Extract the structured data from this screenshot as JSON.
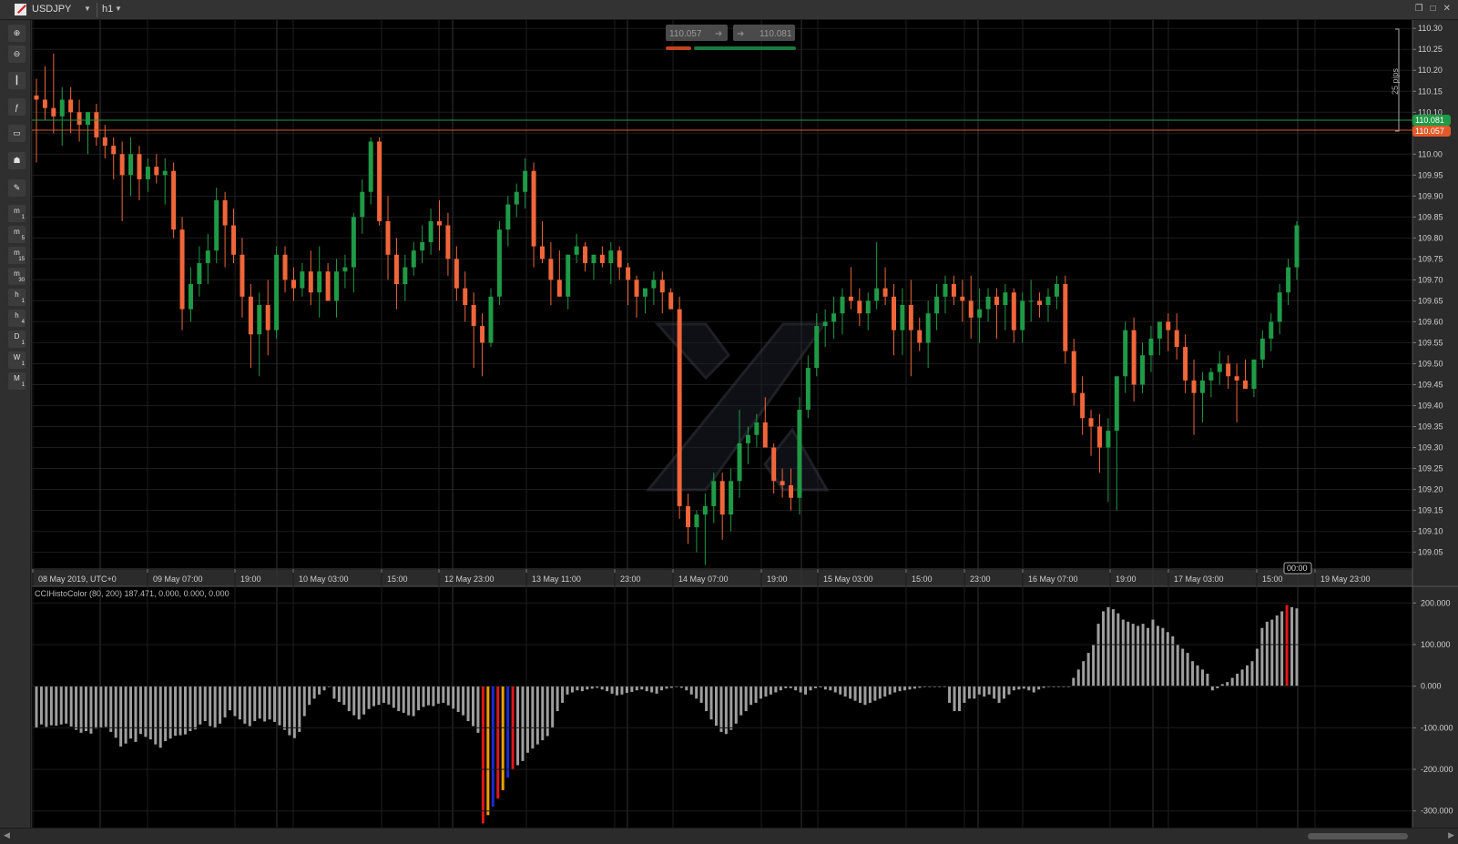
{
  "header": {
    "symbol": "USDJPY",
    "timeframe": "h1",
    "icons": [
      "dropdown-icon",
      "restore-icon",
      "maximize-icon",
      "close-icon"
    ]
  },
  "toolbar": {
    "tools": [
      {
        "name": "zoom-in",
        "icon": "zoom-in-icon"
      },
      {
        "name": "zoom-out",
        "icon": "zoom-out-icon"
      },
      {
        "name": "chart-type",
        "icon": "candles-icon"
      },
      {
        "name": "indicators",
        "icon": "indicator-icon"
      },
      {
        "name": "objects",
        "icon": "objects-icon"
      },
      {
        "name": "templates",
        "icon": "user-icon"
      },
      {
        "name": "settings",
        "icon": "settings-icon"
      }
    ],
    "timeframes": [
      {
        "main": "m",
        "sub": "1"
      },
      {
        "main": "m",
        "sub": "5"
      },
      {
        "main": "m",
        "sub": "15"
      },
      {
        "main": "m",
        "sub": "30"
      },
      {
        "main": "h",
        "sub": "1"
      },
      {
        "main": "h",
        "sub": "4"
      },
      {
        "main": "D",
        "sub": "1"
      },
      {
        "main": "W",
        "sub": "1"
      },
      {
        "main": "M",
        "sub": "1"
      }
    ]
  },
  "quick_trade": {
    "sell_price": "110.057",
    "buy_price": "110.081"
  },
  "price_scale": {
    "labels": [
      "110.30",
      "110.25",
      "110.20",
      "110.15",
      "110.10",
      "110.05",
      "110.00",
      "109.95",
      "109.90",
      "109.85",
      "109.80",
      "109.75",
      "109.70",
      "109.65",
      "109.60",
      "109.55",
      "109.50",
      "109.45",
      "109.40",
      "109.35",
      "109.30",
      "109.25",
      "109.20",
      "109.15",
      "109.10",
      "109.05"
    ],
    "ask_label": "110.081",
    "bid_label": "110.057",
    "pips_label": "25 pips",
    "ask_color": "#1f9a46",
    "bid_color": "#e05a28"
  },
  "time_scale": {
    "labels": [
      "08 May 2019, UTC+0",
      "09 May 07:00",
      "19:00",
      "10 May 03:00",
      "15:00",
      "12 May 23:00",
      "13 May 11:00",
      "23:00",
      "14 May 07:00",
      "19:00",
      "15 May 03:00",
      "15:00",
      "23:00",
      "16 May 07:00",
      "19:00",
      "17 May 03:00",
      "15:00",
      "19 May 23:00"
    ],
    "cursor_label": "00:00"
  },
  "indicator": {
    "title": "CCIHistoColor (80, 200) 187.471, 0.000, 0.000, 0.000",
    "scale_labels": [
      "200.000",
      "100.000",
      "0.000",
      "-100.000",
      "-200.000",
      "-300.000"
    ]
  },
  "colors": {
    "background": "#000000",
    "bull": "#1f9a46",
    "bear": "#f0663a",
    "histogram": "#9e9e9e",
    "hist_red": "#e01818",
    "hist_orange": "#f0a000",
    "hist_blue": "#1a2ad8"
  },
  "chart_data": {
    "type": "candlestick",
    "title": "",
    "ylim": [
      109.01,
      110.32
    ],
    "candle_count": 152,
    "ohlc": [
      [
        110.14,
        110.18,
        109.98,
        110.13
      ],
      [
        110.13,
        110.21,
        110.08,
        110.11
      ],
      [
        110.11,
        110.24,
        110.05,
        110.09
      ],
      [
        110.09,
        110.16,
        110.02,
        110.13
      ],
      [
        110.13,
        110.16,
        110.05,
        110.1
      ],
      [
        110.1,
        110.13,
        110.03,
        110.07
      ],
      [
        110.07,
        110.1,
        110.0,
        110.1
      ],
      [
        110.1,
        110.12,
        110.02,
        110.04
      ],
      [
        110.04,
        110.07,
        109.99,
        110.02
      ],
      [
        110.02,
        110.04,
        109.94,
        110.0
      ],
      [
        110.0,
        110.03,
        109.84,
        109.95
      ],
      [
        109.95,
        110.04,
        109.9,
        110.0
      ],
      [
        110.0,
        110.02,
        109.89,
        109.94
      ],
      [
        109.94,
        109.99,
        109.91,
        109.97
      ],
      [
        109.97,
        110.0,
        109.93,
        109.95
      ],
      [
        109.95,
        109.99,
        109.88,
        109.96
      ],
      [
        109.96,
        109.98,
        109.8,
        109.82
      ],
      [
        109.82,
        109.85,
        109.58,
        109.63
      ],
      [
        109.63,
        109.73,
        109.6,
        109.69
      ],
      [
        109.69,
        109.78,
        109.66,
        109.74
      ],
      [
        109.74,
        109.81,
        109.69,
        109.77
      ],
      [
        109.77,
        109.92,
        109.74,
        109.89
      ],
      [
        109.89,
        109.91,
        109.73,
        109.83
      ],
      [
        109.83,
        109.87,
        109.74,
        109.76
      ],
      [
        109.76,
        109.8,
        109.61,
        109.66
      ],
      [
        109.66,
        109.69,
        109.49,
        109.57
      ],
      [
        109.57,
        109.67,
        109.47,
        109.64
      ],
      [
        109.64,
        109.7,
        109.52,
        109.58
      ],
      [
        109.58,
        109.78,
        109.56,
        109.76
      ],
      [
        109.76,
        109.78,
        109.67,
        109.7
      ],
      [
        109.7,
        109.73,
        109.65,
        109.68
      ],
      [
        109.68,
        109.74,
        109.66,
        109.72
      ],
      [
        109.72,
        109.77,
        109.64,
        109.67
      ],
      [
        109.67,
        109.78,
        109.61,
        109.72
      ],
      [
        109.72,
        109.74,
        109.65,
        109.65
      ],
      [
        109.65,
        109.75,
        109.61,
        109.72
      ],
      [
        109.72,
        109.76,
        109.68,
        109.73
      ],
      [
        109.73,
        109.86,
        109.67,
        109.85
      ],
      [
        109.85,
        109.94,
        109.81,
        109.91
      ],
      [
        109.91,
        110.04,
        109.88,
        110.03
      ],
      [
        110.03,
        110.04,
        109.83,
        109.84
      ],
      [
        109.84,
        109.9,
        109.7,
        109.76
      ],
      [
        109.76,
        109.8,
        109.63,
        109.69
      ],
      [
        109.69,
        109.76,
        109.65,
        109.73
      ],
      [
        109.73,
        109.79,
        109.71,
        109.77
      ],
      [
        109.77,
        109.83,
        109.74,
        109.79
      ],
      [
        109.79,
        109.87,
        109.76,
        109.84
      ],
      [
        109.84,
        109.89,
        109.77,
        109.83
      ],
      [
        109.83,
        109.86,
        109.71,
        109.75
      ],
      [
        109.75,
        109.78,
        109.65,
        109.68
      ],
      [
        109.68,
        109.72,
        109.6,
        109.64
      ],
      [
        109.64,
        109.67,
        109.49,
        109.59
      ],
      [
        109.59,
        109.62,
        109.47,
        109.55
      ],
      [
        109.55,
        109.68,
        109.54,
        109.66
      ],
      [
        109.66,
        109.84,
        109.64,
        109.82
      ],
      [
        109.82,
        109.9,
        109.78,
        109.88
      ],
      [
        109.88,
        109.93,
        109.85,
        109.91
      ],
      [
        109.91,
        109.99,
        109.87,
        109.96
      ],
      [
        109.96,
        109.98,
        109.73,
        109.78
      ],
      [
        109.78,
        109.84,
        109.74,
        109.75
      ],
      [
        109.75,
        109.79,
        109.64,
        109.7
      ],
      [
        109.7,
        109.77,
        109.66,
        109.66
      ],
      [
        109.66,
        109.76,
        109.63,
        109.76
      ],
      [
        109.76,
        109.81,
        109.74,
        109.78
      ],
      [
        109.78,
        109.79,
        109.72,
        109.74
      ],
      [
        109.74,
        109.76,
        109.7,
        109.76
      ],
      [
        109.76,
        109.78,
        109.73,
        109.74
      ],
      [
        109.74,
        109.79,
        109.69,
        109.77
      ],
      [
        109.77,
        109.78,
        109.7,
        109.73
      ],
      [
        109.73,
        109.74,
        109.64,
        109.7
      ],
      [
        109.7,
        109.71,
        109.61,
        109.66
      ],
      [
        109.66,
        109.68,
        109.62,
        109.68
      ],
      [
        109.68,
        109.72,
        109.64,
        109.7
      ],
      [
        109.7,
        109.72,
        109.62,
        109.67
      ],
      [
        109.67,
        109.68,
        109.63,
        109.63
      ],
      [
        109.63,
        109.66,
        109.13,
        109.16
      ],
      [
        109.16,
        109.19,
        109.07,
        109.11
      ],
      [
        109.11,
        109.15,
        109.05,
        109.14
      ],
      [
        109.14,
        109.19,
        109.02,
        109.16
      ],
      [
        109.16,
        109.24,
        109.12,
        109.22
      ],
      [
        109.22,
        109.24,
        109.08,
        109.14
      ],
      [
        109.14,
        109.25,
        109.1,
        109.22
      ],
      [
        109.22,
        109.39,
        109.18,
        109.31
      ],
      [
        109.31,
        109.35,
        109.26,
        109.33
      ],
      [
        109.33,
        109.38,
        109.3,
        109.36
      ],
      [
        109.36,
        109.42,
        109.32,
        109.3
      ],
      [
        109.3,
        109.31,
        109.19,
        109.22
      ],
      [
        109.22,
        109.25,
        109.18,
        109.21
      ],
      [
        109.21,
        109.25,
        109.15,
        109.18
      ],
      [
        109.18,
        109.42,
        109.14,
        109.39
      ],
      [
        109.39,
        109.52,
        109.37,
        109.49
      ],
      [
        109.49,
        109.62,
        109.47,
        109.59
      ],
      [
        109.59,
        109.63,
        109.54,
        109.6
      ],
      [
        109.6,
        109.66,
        109.56,
        109.62
      ],
      [
        109.62,
        109.68,
        109.57,
        109.66
      ],
      [
        109.66,
        109.73,
        109.63,
        109.65
      ],
      [
        109.65,
        109.68,
        109.59,
        109.62
      ],
      [
        109.62,
        109.67,
        109.58,
        109.65
      ],
      [
        109.65,
        109.79,
        109.63,
        109.68
      ],
      [
        109.68,
        109.73,
        109.64,
        109.66
      ],
      [
        109.66,
        109.69,
        109.52,
        109.58
      ],
      [
        109.58,
        109.68,
        109.52,
        109.64
      ],
      [
        109.64,
        109.7,
        109.47,
        109.58
      ],
      [
        109.58,
        109.61,
        109.53,
        109.55
      ],
      [
        109.55,
        109.65,
        109.49,
        109.62
      ],
      [
        109.62,
        109.69,
        109.58,
        109.66
      ],
      [
        109.66,
        109.71,
        109.62,
        109.69
      ],
      [
        109.69,
        109.71,
        109.64,
        109.66
      ],
      [
        109.66,
        109.7,
        109.6,
        109.65
      ],
      [
        109.65,
        109.71,
        109.56,
        109.61
      ],
      [
        109.61,
        109.68,
        109.55,
        109.63
      ],
      [
        109.63,
        109.68,
        109.6,
        109.66
      ],
      [
        109.66,
        109.68,
        109.56,
        109.64
      ],
      [
        109.64,
        109.69,
        109.58,
        109.67
      ],
      [
        109.67,
        109.68,
        109.55,
        109.58
      ],
      [
        109.58,
        109.67,
        109.55,
        109.65
      ],
      [
        109.65,
        109.7,
        109.6,
        109.65
      ],
      [
        109.65,
        109.67,
        109.61,
        109.64
      ],
      [
        109.64,
        109.68,
        109.6,
        109.66
      ],
      [
        109.66,
        109.71,
        109.63,
        109.69
      ],
      [
        109.69,
        109.71,
        109.5,
        109.53
      ],
      [
        109.53,
        109.56,
        109.4,
        109.43
      ],
      [
        109.43,
        109.47,
        109.33,
        109.37
      ],
      [
        109.37,
        109.39,
        109.28,
        109.35
      ],
      [
        109.35,
        109.38,
        109.24,
        109.3
      ],
      [
        109.3,
        109.37,
        109.17,
        109.34
      ],
      [
        109.34,
        109.45,
        109.15,
        109.47
      ],
      [
        109.47,
        109.6,
        109.43,
        109.58
      ],
      [
        109.58,
        109.61,
        109.41,
        109.45
      ],
      [
        109.45,
        109.55,
        109.43,
        109.52
      ],
      [
        109.52,
        109.59,
        109.48,
        109.56
      ],
      [
        109.56,
        109.6,
        109.52,
        109.6
      ],
      [
        109.6,
        109.62,
        109.53,
        109.58
      ],
      [
        109.58,
        109.62,
        109.51,
        109.54
      ],
      [
        109.54,
        109.57,
        109.43,
        109.46
      ],
      [
        109.46,
        109.51,
        109.33,
        109.43
      ],
      [
        109.43,
        109.48,
        109.36,
        109.46
      ],
      [
        109.46,
        109.49,
        109.42,
        109.48
      ],
      [
        109.48,
        109.53,
        109.45,
        109.5
      ],
      [
        109.5,
        109.52,
        109.44,
        109.47
      ],
      [
        109.47,
        109.5,
        109.36,
        109.46
      ],
      [
        109.46,
        109.51,
        109.44,
        109.44
      ],
      [
        109.44,
        109.5,
        109.42,
        109.51
      ],
      [
        109.51,
        109.58,
        109.49,
        109.56
      ],
      [
        109.56,
        109.62,
        109.53,
        109.6
      ],
      [
        109.6,
        109.69,
        109.57,
        109.67
      ],
      [
        109.67,
        109.75,
        109.64,
        109.73
      ],
      [
        109.73,
        109.84,
        109.7,
        109.83
      ]
    ],
    "cci_values": [
      -100,
      -92,
      -98,
      -94,
      -95,
      -92,
      -90,
      -97,
      -105,
      -112,
      -108,
      -114,
      -102,
      -100,
      -98,
      -110,
      -124,
      -145,
      -138,
      -126,
      -134,
      -115,
      -122,
      -128,
      -140,
      -148,
      -132,
      -126,
      -119,
      -118,
      -116,
      -108,
      -104,
      -92,
      -84,
      -96,
      -101,
      -90,
      -75,
      -58,
      -72,
      -80,
      -90,
      -96,
      -84,
      -78,
      -85,
      -80,
      -86,
      -94,
      -105,
      -118,
      -125,
      -110,
      -72,
      -45,
      -30,
      -20,
      -10,
      0,
      -30,
      -38,
      -45,
      -60,
      -70,
      -80,
      -68,
      -55,
      -48,
      -45,
      -40,
      -44,
      -52,
      -60,
      -64,
      -70,
      -72,
      -58,
      -50,
      -46,
      -48,
      -42,
      -40,
      -46,
      -54,
      -62,
      -70,
      -84,
      -96,
      -112,
      -330,
      -310,
      -290,
      -270,
      -250,
      -220,
      -200,
      -190,
      -180,
      -160,
      -150,
      -140,
      -130,
      -120,
      -100,
      -60,
      -40,
      -20,
      -15,
      -10,
      -12,
      -8,
      -6,
      -4,
      -8,
      -12,
      -18,
      -22,
      -20,
      -16,
      -14,
      -10,
      -8,
      -12,
      -15,
      -18,
      -10,
      -6,
      -4,
      -2,
      -4,
      -10,
      -20,
      -30,
      -40,
      -60,
      -80,
      -95,
      -110,
      -115,
      -105,
      -90,
      -70,
      -60,
      -45,
      -40,
      -30,
      -25,
      -20,
      -15,
      -10,
      -5,
      -5,
      -10,
      -15,
      -20,
      -10,
      -5,
      -3,
      -8,
      -10,
      -15,
      -20,
      -25,
      -30,
      -35,
      -40,
      -45,
      -40,
      -35,
      -30,
      -25,
      -20,
      -15,
      -12,
      -10,
      -8,
      -6,
      -4,
      -2,
      -1,
      0,
      0,
      0,
      -40,
      -60,
      -60,
      -40,
      -30,
      -30,
      -20,
      -25,
      -20,
      -30,
      -40,
      -30,
      -20,
      -10,
      -8,
      -6,
      -10,
      -15,
      -8,
      -4,
      -2,
      -1,
      0,
      0,
      0,
      20,
      40,
      60,
      80,
      100,
      150,
      180,
      190,
      185,
      175,
      160,
      155,
      150,
      145,
      150,
      140,
      160,
      145,
      140,
      130,
      120,
      100,
      90,
      80,
      60,
      50,
      40,
      30,
      -10,
      -5,
      5,
      10,
      20,
      30,
      40,
      50,
      60,
      90,
      140,
      155,
      160,
      170,
      180,
      195,
      190,
      187
    ]
  }
}
